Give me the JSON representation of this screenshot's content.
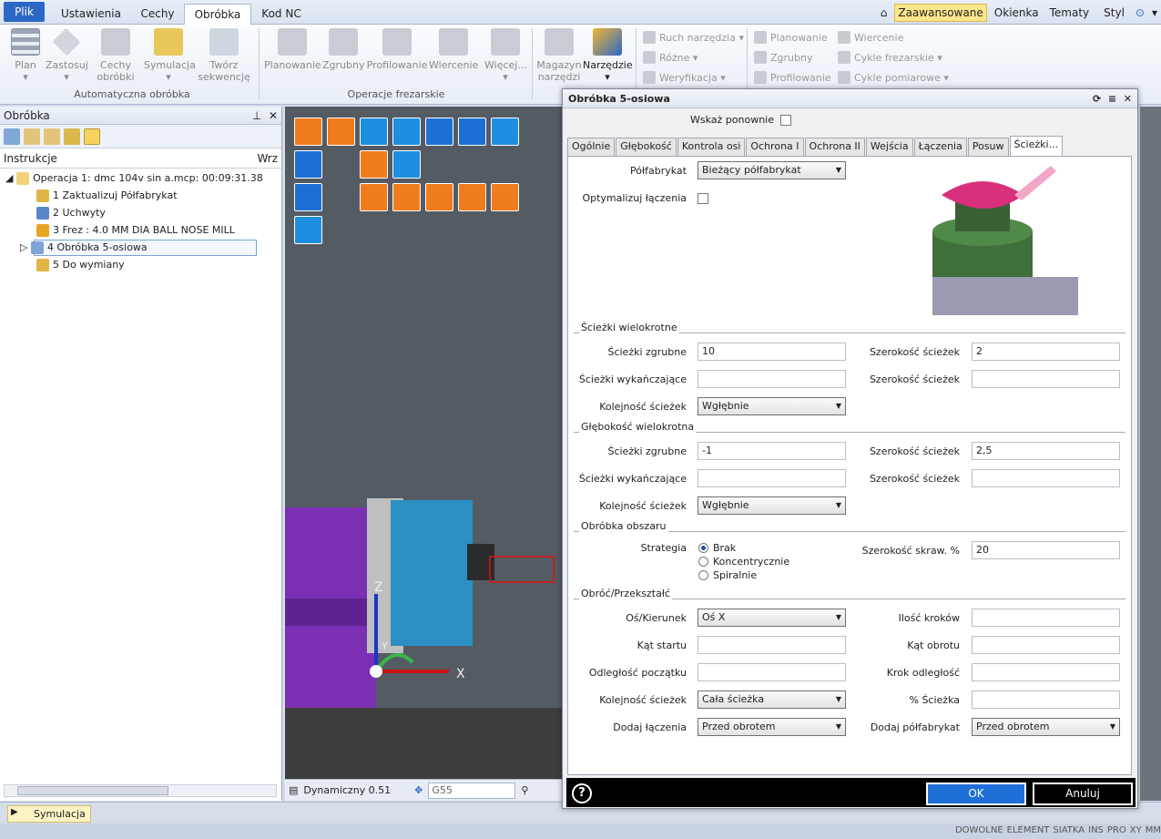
{
  "menu_tabs": [
    {
      "label": "Plik"
    },
    {
      "label": "Ustawienia"
    },
    {
      "label": "Cechy"
    },
    {
      "label": "Obróbka"
    },
    {
      "label": "Kod NC"
    }
  ],
  "right_menu": {
    "advanced": "Zaawansowane",
    "windows": "Okienka",
    "themes": "Tematy",
    "style": "Styl"
  },
  "ribbon": {
    "group1": {
      "label": "Automatyczna obróbka",
      "plan": "Plan",
      "apply": "Zastosuj",
      "features1": "Cechy",
      "features2": "obróbki",
      "simulation": "Symulacja",
      "create1": "Twórz",
      "create2": "sekwencję"
    },
    "group2": {
      "label": "Operacje frezarskie",
      "planning": "Planowanie",
      "rough": "Zgrubny",
      "profiling": "Profilowanie",
      "drilling": "Wiercenie",
      "more": "Więcej..."
    },
    "group3": {
      "magazine1": "Magazyn",
      "magazine2": "narzędzi",
      "tools": "Narzędzie"
    },
    "small_col1": [
      "Ruch narzędzia",
      "Różne",
      "Weryfikacja"
    ],
    "small_col2": [
      "Planowanie",
      "Zgrubny",
      "Profilowanie"
    ],
    "small_col3": [
      "Wiercenie",
      "Cykle frezarskie",
      "Cykle pomiarowe"
    ]
  },
  "left_panel": {
    "title": "Obróbka",
    "col_instr": "Instrukcje",
    "col_wrz": "Wrz",
    "items": [
      {
        "label": "Operacja 1: dmc 104v sin a.mcp: 00:09:31.38"
      },
      {
        "label": "1 Zaktualizuj Półfabrykat"
      },
      {
        "label": "2 Uchwyty"
      },
      {
        "label": "3 Frez : 4.0 MM DIA BALL NOSE MILL"
      },
      {
        "label": "4 Obróbka 5-osiowa"
      },
      {
        "label": "5 Do wymiany"
      }
    ]
  },
  "viewport": {
    "mode": "Dynamiczny 0.51",
    "wcs": "G55",
    "axis_z": "Z",
    "axis_x": "X",
    "axis_y": "Y"
  },
  "bottom": {
    "sim_tab": "Symulacja",
    "status": [
      "DOWOLNE",
      "ELEMENT",
      "SIATKA",
      "INS",
      "PRO",
      "XY",
      "MM"
    ]
  },
  "dialog": {
    "title": "Obróbka 5-osiowa",
    "show_again": "Wskaż ponownie",
    "tabs": [
      "Ogólnie",
      "Głębokość",
      "Kontrola osi",
      "Ochrona I",
      "Ochrona II",
      "Wejścia",
      "Łączenia",
      "Posuw",
      "Ścieżki..."
    ],
    "stock_label": "Półfabrykat",
    "stock_value": "Bieżący półfabrykat",
    "optimize_label": "Optymalizuj łączenia",
    "multi_paths": {
      "title": "Ścieżki wielokrotne",
      "rough_label": "Ścieżki zgrubne",
      "rough_value": "10",
      "width1_label": "Szerokość ścieżek",
      "width1_value": "2",
      "finish_label": "Ścieżki wykańczające",
      "finish_value": "",
      "width2_label": "Szerokość ścieżek",
      "width2_value": "",
      "order_label": "Kolejność ścieżek",
      "order_value": "Wgłębnie"
    },
    "multi_depth": {
      "title": "Głębokość wielokrotna",
      "rough_label": "Ścieżki zgrubne",
      "rough_value": "-1",
      "width1_label": "Szerokość ścieżek",
      "width1_value": "2,5",
      "finish_label": "Ścieżki wykańczające",
      "finish_value": "",
      "width2_label": "Szerokość ścieżek",
      "width2_value": "",
      "order_label": "Kolejność ścieżek",
      "order_value": "Wgłębnie"
    },
    "area": {
      "title": "Obróbka obszaru",
      "strategy_label": "Strategia",
      "options": [
        "Brak",
        "Koncentrycznie",
        "Spiralnie"
      ],
      "selected": "Brak",
      "cut_width_label": "Szerokość skraw. %",
      "cut_width_value": "20"
    },
    "rotate": {
      "title": "Obróć/Przekształć",
      "axis_label": "Oś/Kierunek",
      "axis_value": "Oś X",
      "steps_label": "Ilość kroków",
      "steps_value": "",
      "start_angle_label": "Kąt startu",
      "start_angle_value": "",
      "rot_angle_label": "Kąt obrotu",
      "rot_angle_value": "",
      "start_dist_label": "Odległość początku",
      "start_dist_value": "",
      "step_dist_label": "Krok odległość",
      "step_dist_value": "",
      "order_label": "Kolejność ścieżek",
      "order_value": "Cała ścieżka",
      "pct_label": "% Ścieżka",
      "pct_value": "",
      "add_links_label": "Dodaj łączenia",
      "add_links_value": "Przed obrotem",
      "add_stock_label": "Dodaj półfabrykat",
      "add_stock_value": "Przed obrotem"
    },
    "ok": "OK",
    "cancel": "Anuluj",
    "help": "?"
  }
}
